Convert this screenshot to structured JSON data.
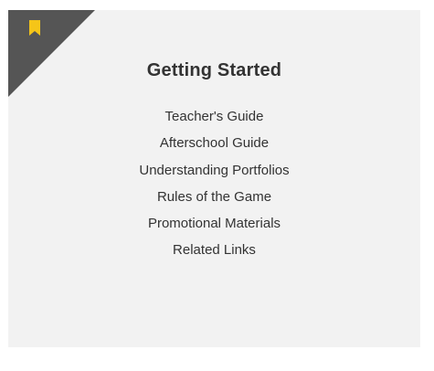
{
  "card": {
    "title": "Getting Started",
    "links": [
      {
        "label": "Teacher's Guide"
      },
      {
        "label": "Afterschool Guide"
      },
      {
        "label": "Understanding Portfolios"
      },
      {
        "label": "Rules of the Game"
      },
      {
        "label": "Promotional Materials"
      },
      {
        "label": "Related Links"
      }
    ]
  },
  "icons": {
    "corner": "corner-ribbon-icon",
    "bookmark": "bookmark-icon"
  },
  "colors": {
    "card_background": "#f2f2f2",
    "corner_ribbon": "#555555",
    "bookmark": "#f5c518",
    "text": "#333333"
  }
}
